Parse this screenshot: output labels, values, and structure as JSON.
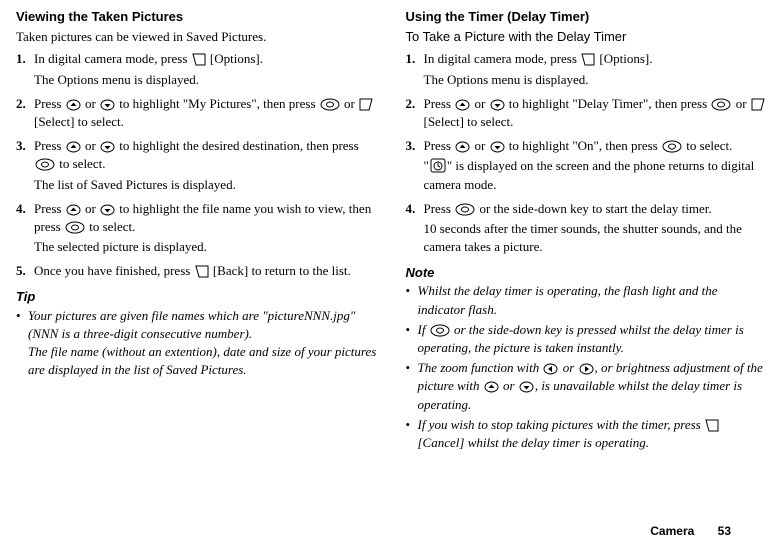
{
  "left": {
    "heading": "Viewing the Taken Pictures",
    "intro": "Taken pictures can be viewed in Saved Pictures.",
    "steps": [
      {
        "num": "1.",
        "lines": [
          "In digital camera mode, press {softR} [Options].",
          "The Options menu is displayed."
        ]
      },
      {
        "num": "2.",
        "lines": [
          "Press {up} or {down} to highlight \"My Pictures\", then press {circle} or {softL} [Select] to select."
        ]
      },
      {
        "num": "3.",
        "lines": [
          "Press {up} or {down} to highlight the desired destination, then press {circle} to select.",
          "The list of Saved Pictures is displayed."
        ]
      },
      {
        "num": "4.",
        "lines": [
          "Press {up} or {down} to highlight the file name you wish to view, then press {circle} to select.",
          "The selected picture is displayed."
        ]
      },
      {
        "num": "5.",
        "lines": [
          "Once you have finished, press {softR} [Back] to return to the list."
        ]
      }
    ],
    "tip_label": "Tip",
    "tips": [
      "Your pictures are given file names which are \"pictureNNN.jpg\" (NNN is a three-digit consecutive number).\nThe file name (without an extention), date and size of your pictures are displayed in the list of Saved Pictures."
    ]
  },
  "right": {
    "heading": "Using the Timer (Delay Timer)",
    "subheading": "To Take a Picture with the Delay Timer",
    "steps": [
      {
        "num": "1.",
        "lines": [
          "In digital camera mode, press {softR} [Options].",
          "The Options menu is displayed."
        ]
      },
      {
        "num": "2.",
        "lines": [
          "Press {up} or {down} to highlight \"Delay Timer\", then press {circle} or {softL} [Select] to select."
        ]
      },
      {
        "num": "3.",
        "lines": [
          "Press {up} or {down} to highlight \"On\", then press {circle} to select.",
          "\"{timer}\" is displayed on the screen and the phone returns to digital camera mode."
        ]
      },
      {
        "num": "4.",
        "lines": [
          "Press {circle} or the side-down key to start the delay timer.",
          "10 seconds after the timer sounds, the shutter sounds, and the camera takes a picture."
        ]
      }
    ],
    "note_label": "Note",
    "notes": [
      "Whilst the delay timer is operating, the flash light and the indicator flash.",
      "If {circle} or the side-down key is pressed whilst the delay timer is operating, the picture is taken instantly.",
      "The zoom function with {leftkey} or {rightkey}, or brightness adjustment of the picture with {up} or {down}, is unavailable whilst the delay timer is operating.",
      "If you wish to stop taking pictures with the timer, press {softR} [Cancel] whilst the delay timer is operating."
    ]
  },
  "footer": {
    "label": "Camera",
    "page": "53"
  }
}
